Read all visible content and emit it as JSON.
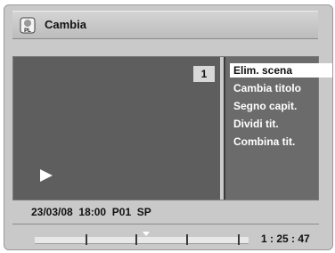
{
  "title_bar": {
    "icon": "playlist-pl-icon",
    "icon_text": "PL",
    "title": "Cambia"
  },
  "video": {
    "title_number": "1",
    "status_icon": "play-icon"
  },
  "menu": {
    "items": [
      {
        "label": "Elim. scena",
        "selected": true
      },
      {
        "label": "Cambia titolo",
        "selected": false
      },
      {
        "label": "Segno capit.",
        "selected": false
      },
      {
        "label": "Dividi tit.",
        "selected": false
      },
      {
        "label": "Combina tit.",
        "selected": false
      }
    ]
  },
  "info": {
    "date": "23/03/08",
    "time": "18:00",
    "program": "P01",
    "mode": "SP"
  },
  "timeline": {
    "elapsed": "1 : 25 : 47",
    "chapter_count": 5
  },
  "colors": {
    "video_background": "#5e5e5e",
    "menu_background": "#6b6b6b",
    "selection": "#ffffff"
  }
}
